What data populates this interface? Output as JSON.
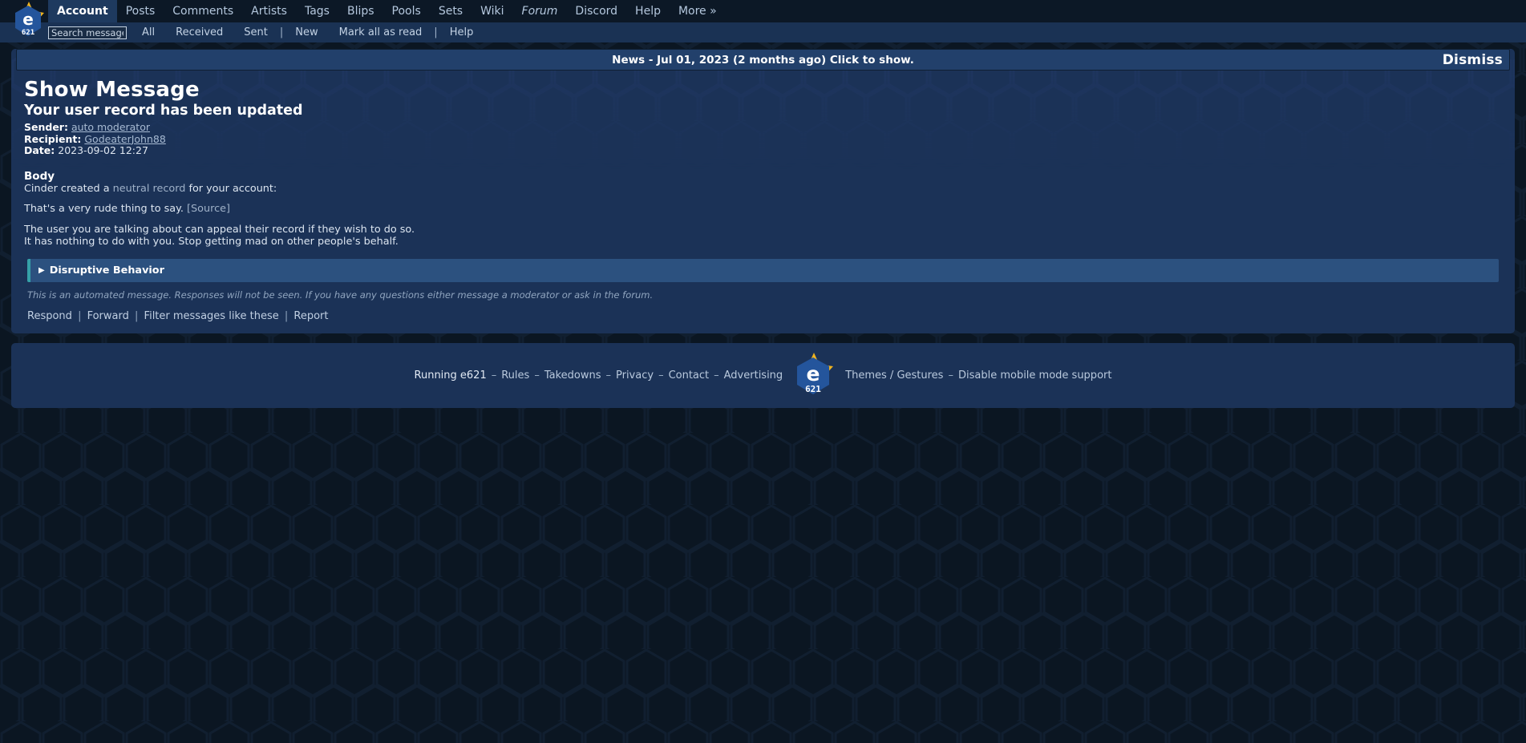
{
  "site": {
    "name": "e621",
    "logo_text": "e",
    "logo_sub": "621"
  },
  "nav": {
    "items": [
      {
        "label": "Account",
        "name": "account",
        "current": true,
        "italic": false
      },
      {
        "label": "Posts",
        "name": "posts",
        "current": false,
        "italic": false
      },
      {
        "label": "Comments",
        "name": "comments",
        "current": false,
        "italic": false
      },
      {
        "label": "Artists",
        "name": "artists",
        "current": false,
        "italic": false
      },
      {
        "label": "Tags",
        "name": "tags",
        "current": false,
        "italic": false
      },
      {
        "label": "Blips",
        "name": "blips",
        "current": false,
        "italic": false
      },
      {
        "label": "Pools",
        "name": "pools",
        "current": false,
        "italic": false
      },
      {
        "label": "Sets",
        "name": "sets",
        "current": false,
        "italic": false
      },
      {
        "label": "Wiki",
        "name": "wiki",
        "current": false,
        "italic": false
      },
      {
        "label": "Forum",
        "name": "forum",
        "current": false,
        "italic": true
      },
      {
        "label": "Discord",
        "name": "discord",
        "current": false,
        "italic": false
      },
      {
        "label": "Help",
        "name": "help",
        "current": false,
        "italic": false
      },
      {
        "label": "More »",
        "name": "more",
        "current": false,
        "italic": false
      }
    ]
  },
  "subnav": {
    "search_placeholder": "Search messages",
    "search_value": "",
    "items": [
      {
        "label": "All",
        "name": "all",
        "sep_after": false
      },
      {
        "label": "Received",
        "name": "received",
        "sep_after": false
      },
      {
        "label": "Sent",
        "name": "sent",
        "sep_after": true
      },
      {
        "label": "New",
        "name": "new",
        "sep_after": false
      },
      {
        "label": "Mark all as read",
        "name": "mark-all-as-read",
        "sep_after": true
      },
      {
        "label": "Help",
        "name": "help",
        "sep_after": false
      }
    ],
    "separator": "|"
  },
  "news": {
    "text": "News - Jul 01, 2023 (2 months ago) Click to show.",
    "dismiss_label": "Dismiss"
  },
  "message": {
    "page_title": "Show Message",
    "subject": "Your user record has been updated",
    "meta": [
      {
        "label": "Sender:",
        "value": "auto moderator",
        "muted": true
      },
      {
        "label": "Recipient:",
        "value": "GodeaterJohn88",
        "muted": true
      },
      {
        "label": "Date:",
        "value": "2023-09-02 12:27",
        "muted": false
      }
    ],
    "body_heading": "Body",
    "intro_before": "Cinder created a ",
    "intro_link": "neutral record",
    "intro_after": " for your account:",
    "quote_text": "That's a very rude thing to say.",
    "quote_source": "[Source]",
    "paragraph_lines": [
      "The user you are talking about can appeal their record if they wish to do so.",
      "It has nothing to do with you. Stop getting mad on other people's behalf."
    ],
    "record": {
      "arrow": "▶",
      "title": "Disruptive Behavior"
    },
    "disclaimer": "This is an automated message. Responses will not be seen. If you have any questions either message a moderator or ask in the forum.",
    "actions": [
      {
        "label": "Respond",
        "name": "respond"
      },
      {
        "label": "Forward",
        "name": "forward"
      },
      {
        "label": "Filter messages like these",
        "name": "filter-messages"
      },
      {
        "label": "Report",
        "name": "report"
      }
    ],
    "action_separator": "|"
  },
  "footer": {
    "left_items": [
      {
        "label": "Running e621",
        "name": "running-e621",
        "strong": true
      },
      {
        "label": "Rules",
        "name": "rules",
        "strong": false
      },
      {
        "label": "Takedowns",
        "name": "takedowns",
        "strong": false
      },
      {
        "label": "Privacy",
        "name": "privacy",
        "strong": false
      },
      {
        "label": "Contact",
        "name": "contact",
        "strong": false
      },
      {
        "label": "Advertising",
        "name": "advertising",
        "strong": false
      }
    ],
    "right_items": [
      {
        "label": "Themes / Gestures",
        "name": "themes-gestures",
        "strong": false
      },
      {
        "label": "Disable mobile mode support",
        "name": "disable-mobile-mode",
        "strong": false
      }
    ],
    "dash": "–"
  },
  "colors": {
    "page_background": "#0b1622",
    "panel": "#1b3257",
    "nav_background": "#0c1826",
    "nav_current": "#1e3a5f",
    "subnav_background": "#1a3254",
    "news_background": "#22406b",
    "record_background": "#2c517f",
    "record_accent": "#35a0a8",
    "logo_blue": "#24559c",
    "logo_gold": "#f0b41f",
    "text_primary": "#ffffff",
    "text_muted": "#a7bad2"
  }
}
